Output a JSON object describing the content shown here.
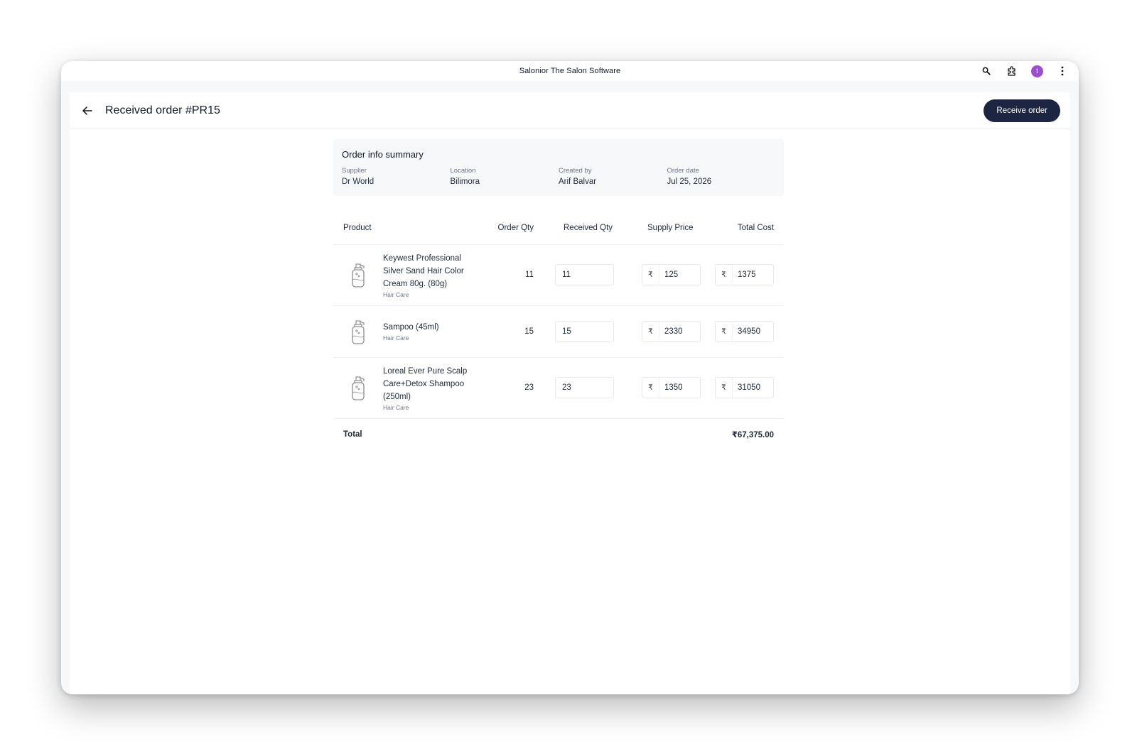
{
  "window": {
    "title": "Salonior The Salon Software",
    "avatar_initial": "t"
  },
  "header": {
    "title": "Received order #PR15",
    "receive_button": "Receive order"
  },
  "summary": {
    "title": "Order info summary",
    "fields": [
      {
        "label": "Supplier",
        "value": "Dr World"
      },
      {
        "label": "Location",
        "value": "Bilimora"
      },
      {
        "label": "Created by",
        "value": "Arif Balvar"
      },
      {
        "label": "Order date",
        "value": "Jul 25, 2026"
      }
    ]
  },
  "table": {
    "columns": [
      "Product",
      "Order Qty",
      "Received Qty",
      "Supply Price",
      "Total Cost"
    ],
    "currency_symbol": "₹",
    "rows": [
      {
        "name": "Keywest Professional Silver Sand Hair Color Cream 80g. (80g)",
        "category": "Hair Care",
        "order_qty": "11",
        "received_qty": "11",
        "supply_price": "125",
        "total_cost": "1375"
      },
      {
        "name": "Sampoo (45ml)",
        "category": "Hair Care",
        "order_qty": "15",
        "received_qty": "15",
        "supply_price": "2330",
        "total_cost": "34950"
      },
      {
        "name": "Loreal Ever Pure Scalp Care+Detox Shampoo (250ml)",
        "category": "Hair Care",
        "order_qty": "23",
        "received_qty": "23",
        "supply_price": "1350",
        "total_cost": "31050"
      }
    ],
    "total_label": "Total",
    "total_value": "₹67,375.00"
  }
}
